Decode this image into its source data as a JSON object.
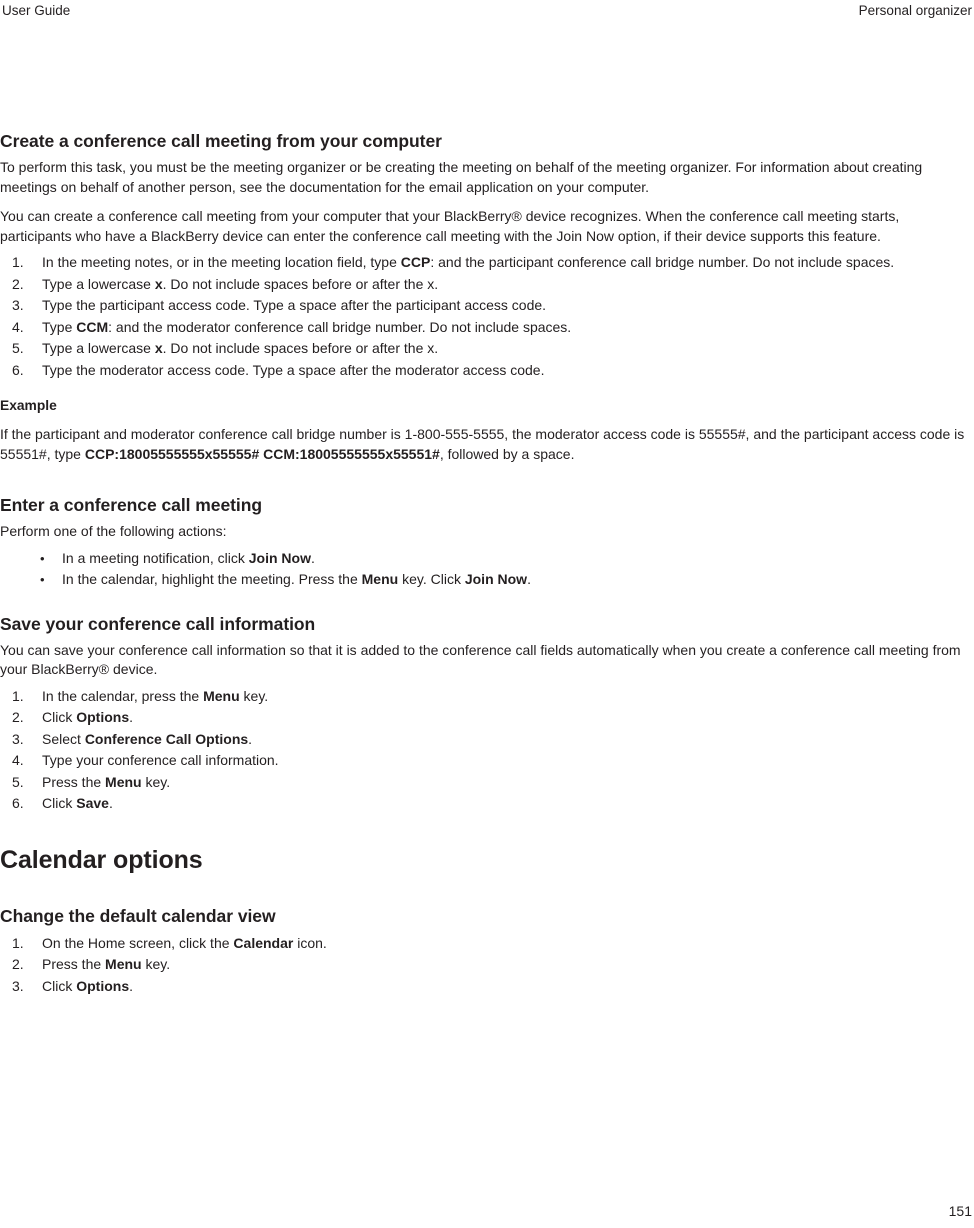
{
  "header": {
    "left": "User Guide",
    "right": "Personal organizer"
  },
  "sections": {
    "create_conference": {
      "heading": "Create a conference call meeting from your computer",
      "para1": "To perform this task, you must be the meeting organizer or be creating the meeting on behalf of the meeting organizer. For information about creating meetings on behalf of another person, see the documentation for the email application on your computer.",
      "para2": "You can create a conference call meeting from your computer that your BlackBerry® device recognizes. When the conference call meeting starts, participants who have a BlackBerry device can enter the conference call meeting with the Join Now option, if their device supports this feature.",
      "steps": [
        {
          "pre": "In the meeting notes, or in the meeting location field, type ",
          "bold": "CCP",
          "post": ": and the participant conference call bridge number. Do not include spaces."
        },
        {
          "pre": "Type a lowercase ",
          "bold": "x",
          "post": ". Do not include spaces before or after the x."
        },
        {
          "pre": "Type the participant access code. Type a space after the participant access code.",
          "bold": "",
          "post": ""
        },
        {
          "pre": "Type ",
          "bold": "CCM",
          "post": ": and the moderator conference call bridge number. Do not include spaces."
        },
        {
          "pre": "Type a lowercase ",
          "bold": "x",
          "post": ". Do not include spaces before or after the x."
        },
        {
          "pre": "Type the moderator access code. Type a space after the moderator access code.",
          "bold": "",
          "post": ""
        }
      ],
      "example_heading": "Example",
      "example_pre": "If the participant and moderator conference call bridge number is 1-800-555-5555, the moderator access code is 55555#, and the participant access code is 55551#, type ",
      "example_code": "CCP:18005555555x55555# CCM:18005555555x55551#",
      "example_post": ", followed by a space."
    },
    "enter_conference": {
      "heading": "Enter a conference call meeting",
      "intro": "Perform one of the following actions:",
      "bullets": [
        {
          "pre": "In a meeting notification, click ",
          "bold": "Join Now",
          "post": "."
        },
        {
          "pre": "In the calendar, highlight the meeting. Press the ",
          "bold": "Menu",
          "mid": " key. Click ",
          "bold2": "Join Now",
          "post": "."
        }
      ]
    },
    "save_conference": {
      "heading": "Save your conference call information",
      "para": "You can save your conference call information so that it is added to the conference call fields automatically when you create a conference call meeting from your BlackBerry® device.",
      "steps": [
        {
          "pre": "In the calendar, press the ",
          "bold": "Menu",
          "post": " key."
        },
        {
          "pre": "Click ",
          "bold": "Options",
          "post": "."
        },
        {
          "pre": "Select ",
          "bold": "Conference Call Options",
          "post": "."
        },
        {
          "pre": "Type your conference call information.",
          "bold": "",
          "post": ""
        },
        {
          "pre": "Press the ",
          "bold": "Menu",
          "post": " key."
        },
        {
          "pre": "Click ",
          "bold": "Save",
          "post": "."
        }
      ]
    },
    "calendar_options": {
      "chapter_heading": "Calendar options",
      "subsection_heading": "Change the default calendar view",
      "steps": [
        {
          "pre": "On the Home screen, click the ",
          "bold": "Calendar",
          "post": " icon."
        },
        {
          "pre": "Press the ",
          "bold": "Menu",
          "post": " key."
        },
        {
          "pre": "Click ",
          "bold": "Options",
          "post": "."
        }
      ]
    }
  },
  "footer": {
    "page_number": "151"
  }
}
